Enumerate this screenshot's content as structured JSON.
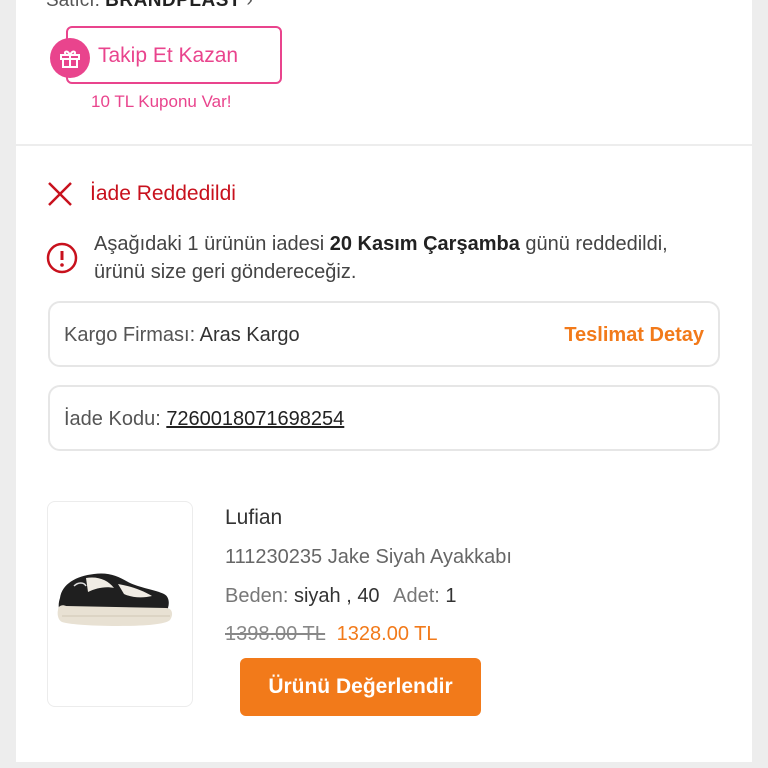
{
  "seller": {
    "label": "Satıcı:",
    "name": "BRANDPLAST"
  },
  "follow": {
    "button_label": "Takip Et Kazan",
    "coupon_note": "10 TL Kuponu Var!"
  },
  "return_status": {
    "title": "İade Reddedildi",
    "message_prefix": "Aşağıdaki 1 ürünün iadesi ",
    "message_date": "20 Kasım Çarşamba",
    "message_suffix": " günü reddedildi, ürünü size geri göndereceğiz."
  },
  "cargo": {
    "label": "Kargo Firması:",
    "company": "Aras Kargo",
    "detail_link": "Teslimat Detay"
  },
  "return_code": {
    "label": "İade Kodu:",
    "code": "7260018071698254"
  },
  "product": {
    "brand": "Lufian",
    "name": "111230235 Jake Siyah Ayakkabı",
    "size_label": "Beden:",
    "size_value": "siyah , 40",
    "qty_label": "Adet:",
    "qty_value": "1",
    "old_price": "1398.00 TL",
    "new_price": "1328.00 TL",
    "rate_button": "Ürünü Değerlendir"
  },
  "colors": {
    "accent_orange": "#f27a1a",
    "accent_pink": "#e9448d",
    "error_red": "#c8111d"
  }
}
